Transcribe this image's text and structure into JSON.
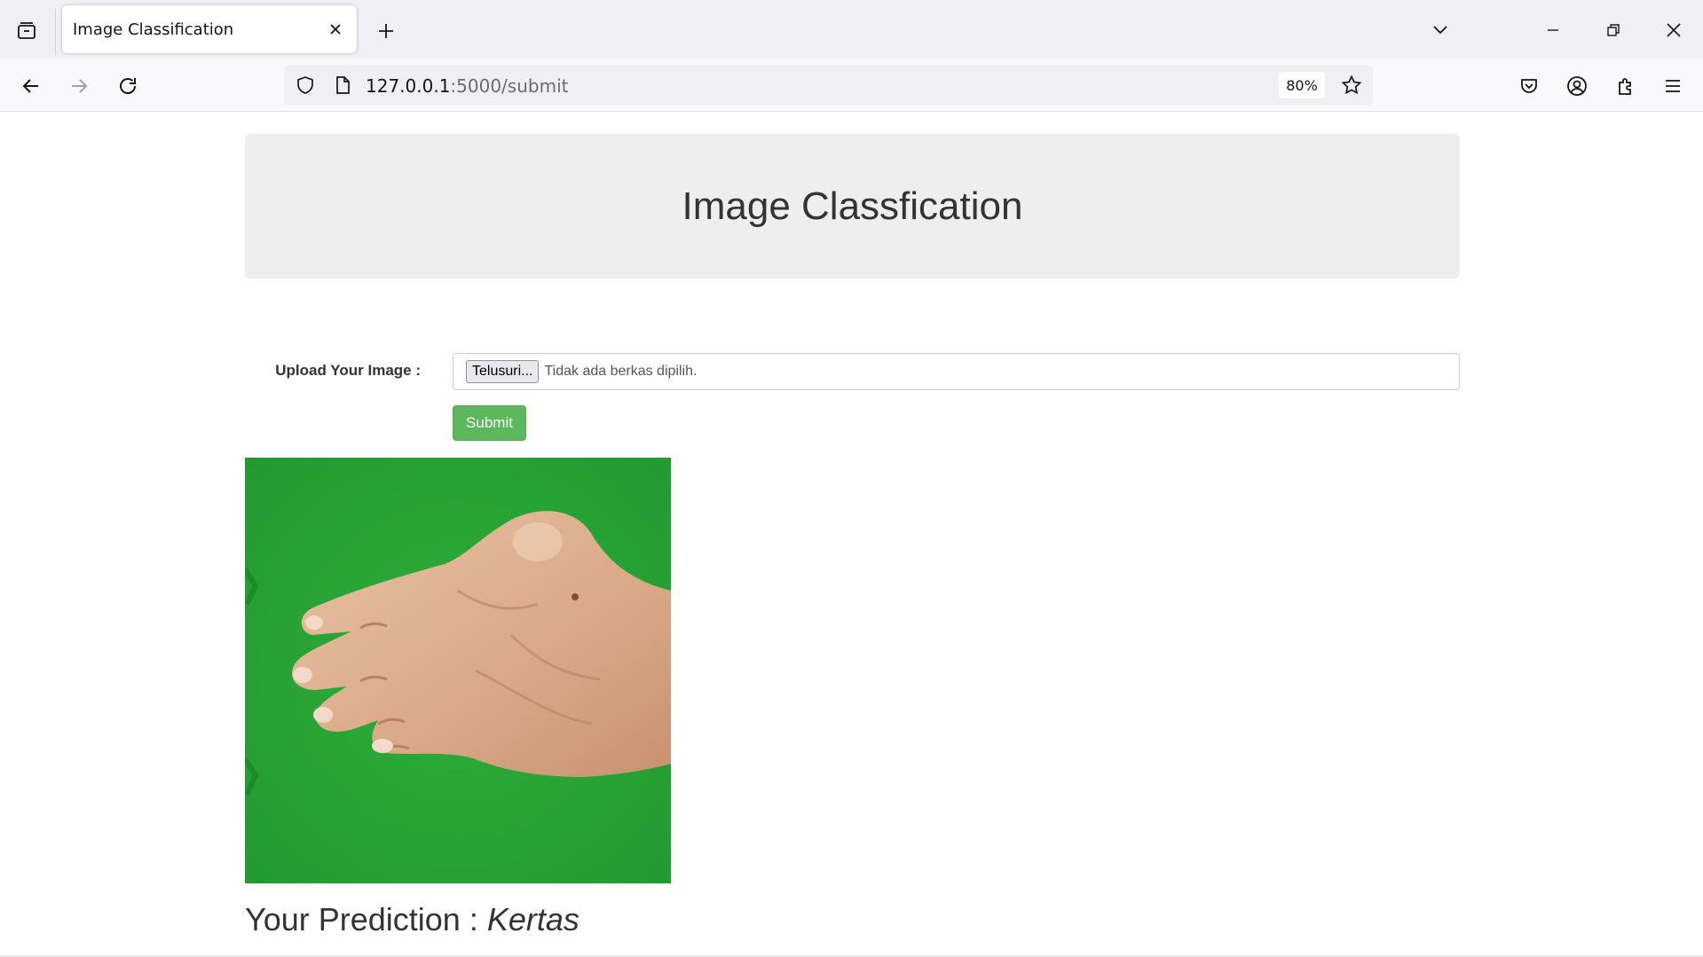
{
  "browser": {
    "tab": {
      "title": "Image Classification"
    },
    "url": {
      "host": "127.0.0.1",
      "path": ":5000/submit"
    },
    "zoom": "80%"
  },
  "page": {
    "heading": "Image Classfication",
    "form": {
      "label": "Upload Your Image :",
      "file_button": "Telusuri...",
      "file_status": "Tidak ada berkas dipilih.",
      "submit": "Submit"
    },
    "prediction": {
      "prefix": "Your Prediction : ",
      "value": "Kertas"
    }
  },
  "colors": {
    "submit": "#5cb85c",
    "jumbotron": "#eeeeee",
    "image_background": "#2ba637"
  }
}
